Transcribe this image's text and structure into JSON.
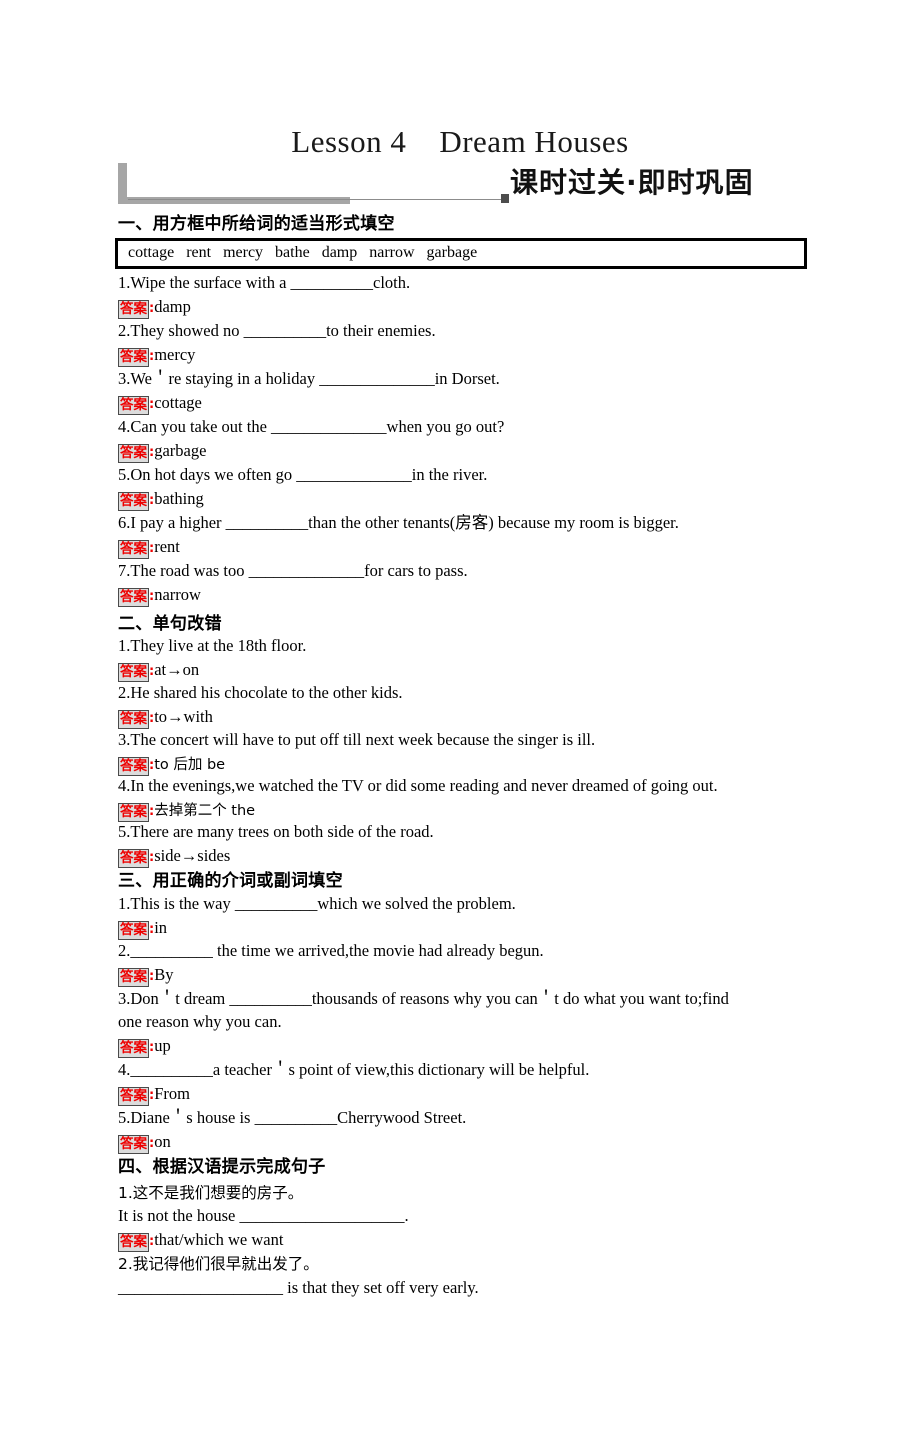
{
  "doc": {
    "title": "Lesson 4    Dream Houses",
    "banner_cn": "课时过关·即时巩固",
    "answer_tag": "答案",
    "answer_colon": ":"
  },
  "sections": [
    {
      "heading": "一、用方框中所给词的适当形式填空",
      "wordbank": "cottage   rent   mercy   bathe   damp   narrow   garbage",
      "items": [
        {
          "q": "1.Wipe the surface with a __________cloth.",
          "a": "damp"
        },
        {
          "q": "2.They showed no __________to their enemies.",
          "a": "mercy"
        },
        {
          "q": "3.We＇re staying in a holiday ______________in Dorset.",
          "a": "cottage"
        },
        {
          "q": "4.Can you take out the ______________when you go out?",
          "a": "garbage"
        },
        {
          "q": "5.On hot days we often go ______________in the river.",
          "a": "bathing"
        },
        {
          "q": "6.I pay a higher __________than the other tenants(房客) because my room is bigger.",
          "a": "rent"
        },
        {
          "q": "7.The road was too ______________for cars to pass.",
          "a": "narrow"
        }
      ]
    },
    {
      "heading": "二、单句改错",
      "items": [
        {
          "q": "1.They live at the 18th floor.",
          "a": "at→on"
        },
        {
          "q": "2.He shared his chocolate to the other kids.",
          "a": "to→with"
        },
        {
          "q": "3.The concert will have to put off till next week because the singer is ill.",
          "a": "to 后加 be"
        },
        {
          "q": "4.In the evenings,we watched the TV or did some reading and never dreamed of going out.",
          "a": "去掉第二个 the"
        },
        {
          "q": "5.There are many trees on both side of the road.",
          "a": "side→sides"
        }
      ]
    },
    {
      "heading": "三、用正确的介词或副词填空",
      "items": [
        {
          "q": "1.This is the way __________which we solved the problem.",
          "a": "in"
        },
        {
          "q": "2.__________ the time we arrived,the movie had already begun.",
          "a": "By"
        },
        {
          "q": "3.Don＇t dream __________thousands of reasons why you can＇t do what you want to;find",
          "q2": "one reason why you can.",
          "a": "up"
        },
        {
          "q": "4.__________a teacher＇s point of view,this dictionary will be helpful.",
          "a": "From"
        },
        {
          "q": "5.Diane＇s house is __________Cherrywood Street.",
          "a": "on"
        }
      ]
    },
    {
      "heading": "四、根据汉语提示完成句子",
      "items": [
        {
          "q": "1.这不是我们想要的房子。",
          "q2": "It is not the house ____________________.",
          "a": "that/which we want"
        },
        {
          "q": "2.我记得他们很早就出发了。",
          "q2": "____________________ is that they set off very early."
        }
      ]
    }
  ]
}
